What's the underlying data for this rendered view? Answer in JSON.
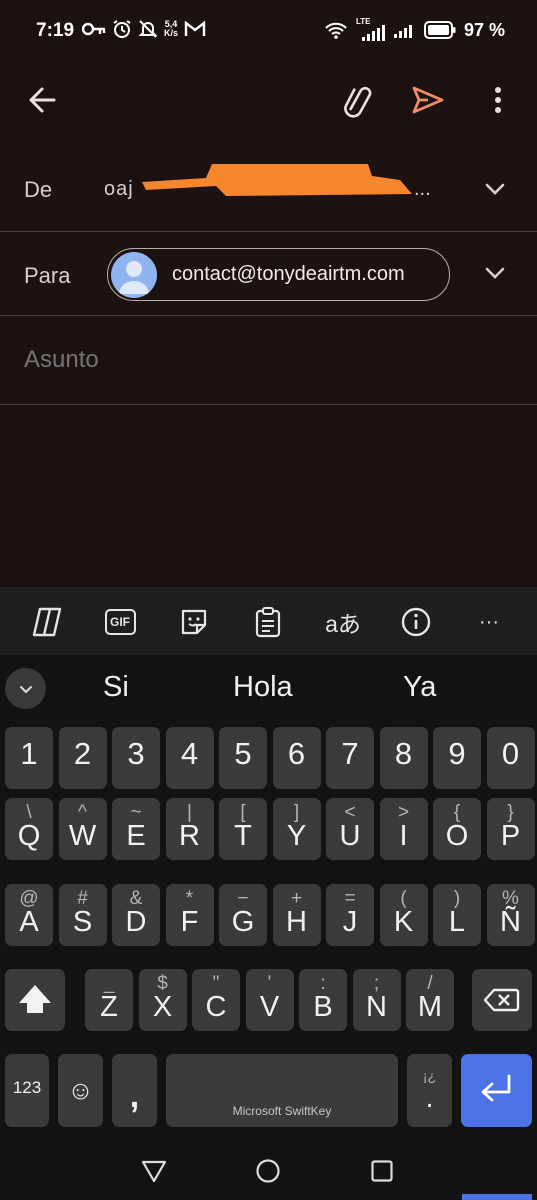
{
  "status_bar": {
    "time": "7:19",
    "net_speed_value": "5,4",
    "net_speed_unit": "K/s",
    "network_label": "LTE",
    "battery_percent": "97 %"
  },
  "app_bar": {
    "back_icon": "arrow-left-icon",
    "attach_icon": "paperclip-icon",
    "send_icon": "send-icon",
    "more_icon": "more-vertical-icon",
    "send_color": "#f08c6c"
  },
  "compose": {
    "from_label": "De",
    "from_value_visible": "...",
    "to_label": "Para",
    "to_chip_email": "contact@tonydeairtm.com",
    "subject_placeholder": "Asunto",
    "redaction_color": "#f5862d"
  },
  "keyboard": {
    "toolbar_icons": [
      "copilot-icon",
      "gif-icon",
      "sticker-icon",
      "clipboard-icon",
      "translate-icon",
      "info-icon",
      "more-horizontal-icon"
    ],
    "gif_label": "GIF",
    "translate_label": "aあ",
    "more_label": "···",
    "suggestions": [
      "Si",
      "Hola",
      "Ya"
    ],
    "number_row": [
      "1",
      "2",
      "3",
      "4",
      "5",
      "6",
      "7",
      "8",
      "9",
      "0"
    ],
    "row1": [
      {
        "main": "Q",
        "sub": "\\"
      },
      {
        "main": "W",
        "sub": "^"
      },
      {
        "main": "E",
        "sub": "~"
      },
      {
        "main": "R",
        "sub": "|"
      },
      {
        "main": "T",
        "sub": "["
      },
      {
        "main": "Y",
        "sub": "]"
      },
      {
        "main": "U",
        "sub": "<"
      },
      {
        "main": "I",
        "sub": ">"
      },
      {
        "main": "O",
        "sub": "{"
      },
      {
        "main": "P",
        "sub": "}"
      }
    ],
    "row2": [
      {
        "main": "A",
        "sub": "@"
      },
      {
        "main": "S",
        "sub": "#"
      },
      {
        "main": "D",
        "sub": "&"
      },
      {
        "main": "F",
        "sub": "*"
      },
      {
        "main": "G",
        "sub": "−"
      },
      {
        "main": "H",
        "sub": "+"
      },
      {
        "main": "J",
        "sub": "="
      },
      {
        "main": "K",
        "sub": "("
      },
      {
        "main": "L",
        "sub": ")"
      },
      {
        "main": "Ñ",
        "sub": "%"
      }
    ],
    "row3": [
      {
        "main": "Z",
        "sub": "_"
      },
      {
        "main": "X",
        "sub": "$"
      },
      {
        "main": "C",
        "sub": "\""
      },
      {
        "main": "V",
        "sub": "'"
      },
      {
        "main": "B",
        "sub": ":"
      },
      {
        "main": "N",
        "sub": ";"
      },
      {
        "main": "M",
        "sub": "/"
      }
    ],
    "symbols_label": "123",
    "emoji_label": "☺",
    "comma_label": ",",
    "space_label": "Microsoft SwiftKey",
    "period_main": ".",
    "period_sub": "¡¿",
    "shift_icon": "shift-icon",
    "backspace_icon": "backspace-icon",
    "enter_icon": "enter-icon",
    "accent_color": "#4d72e8"
  },
  "nav_bar": {
    "back_icon": "triangle-back-icon",
    "home_icon": "circle-home-icon",
    "recents_icon": "square-recents-icon"
  }
}
